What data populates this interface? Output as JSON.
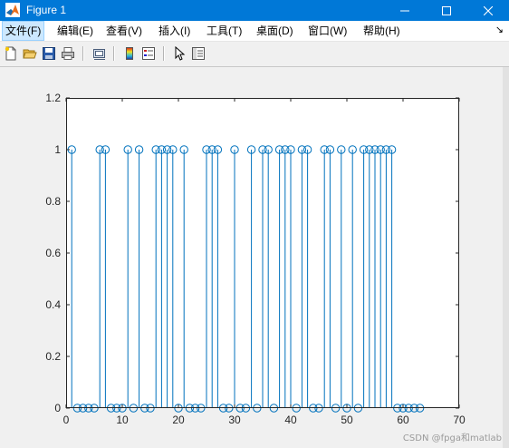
{
  "window": {
    "title": "Figure 1"
  },
  "menu": [
    "文件(F)",
    "编辑(E)",
    "查看(V)",
    "插入(I)",
    "工具(T)",
    "桌面(D)",
    "窗口(W)",
    "帮助(H)"
  ],
  "menu_overflow": "↘",
  "toolbar": [
    "new-figure-icon",
    "open-file-icon",
    "save-icon",
    "print-icon",
    "link-plot-icon",
    "colorbar-icon",
    "legend-icon",
    "pointer-icon",
    "property-inspector-icon"
  ],
  "watermark": "CSDN @fpga和matlab",
  "colors": {
    "stem": "#0072bd",
    "titlebar": "#0078d7",
    "axes_bg": "#ffffff"
  },
  "chart_data": {
    "type": "stem",
    "title": "",
    "xlabel": "",
    "ylabel": "",
    "xlim": [
      0,
      70
    ],
    "ylim": [
      0,
      1.2
    ],
    "xticks": [
      0,
      10,
      20,
      30,
      40,
      50,
      60,
      70
    ],
    "yticks": [
      0,
      0.2,
      0.4,
      0.6,
      0.8,
      1,
      1.2
    ],
    "x": [
      1,
      2,
      3,
      4,
      5,
      6,
      7,
      8,
      9,
      10,
      11,
      12,
      13,
      14,
      15,
      16,
      17,
      18,
      19,
      20,
      21,
      22,
      23,
      24,
      25,
      26,
      27,
      28,
      29,
      30,
      31,
      32,
      33,
      34,
      35,
      36,
      37,
      38,
      39,
      40,
      41,
      42,
      43,
      44,
      45,
      46,
      47,
      48,
      49,
      50,
      51,
      52,
      53,
      54,
      55,
      56,
      57,
      58,
      59,
      60,
      61,
      62,
      63
    ],
    "values": [
      1,
      0,
      0,
      0,
      0,
      1,
      1,
      0,
      0,
      0,
      1,
      0,
      1,
      0,
      0,
      1,
      1,
      1,
      1,
      0,
      1,
      0,
      0,
      0,
      1,
      1,
      1,
      0,
      0,
      1,
      0,
      0,
      1,
      0,
      1,
      1,
      0,
      1,
      1,
      1,
      0,
      1,
      1,
      0,
      0,
      1,
      1,
      0,
      1,
      0,
      1,
      0,
      1,
      1,
      1,
      1,
      1,
      1,
      0,
      0,
      0,
      0,
      0
    ],
    "grid": false,
    "marker": "circle"
  }
}
